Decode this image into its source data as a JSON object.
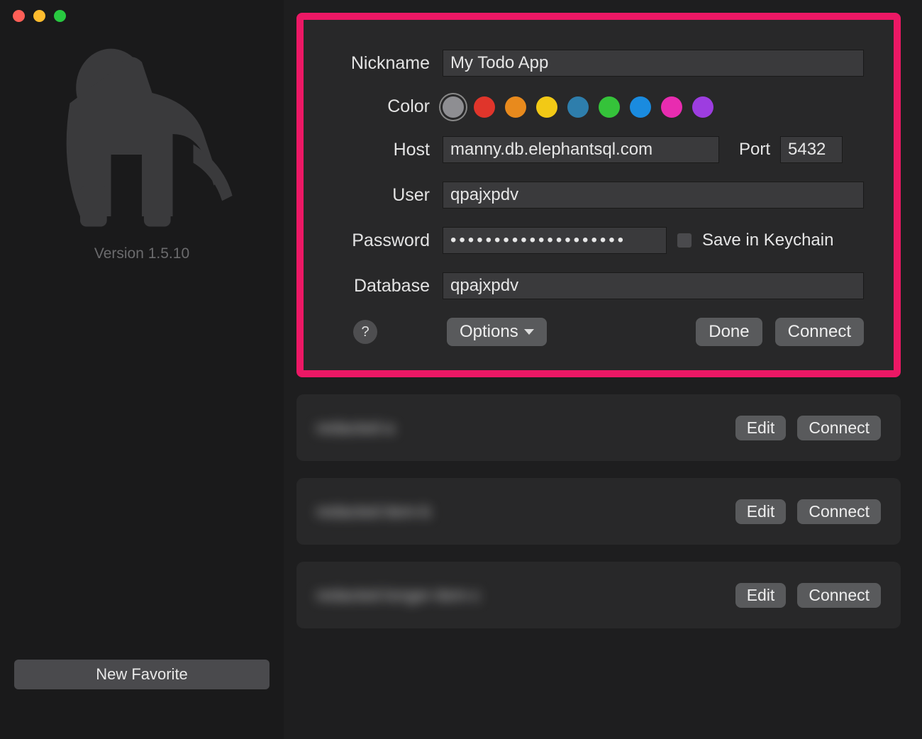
{
  "sidebar": {
    "version_text": "Version 1.5.10",
    "new_favorite_label": "New Favorite"
  },
  "editor": {
    "labels": {
      "nickname": "Nickname",
      "color": "Color",
      "host": "Host",
      "port": "Port",
      "user": "User",
      "password": "Password",
      "database": "Database",
      "save_keychain": "Save in Keychain"
    },
    "values": {
      "nickname": "My Todo App",
      "host": "manny.db.elephantsql.com",
      "port": "5432",
      "user": "qpajxpdv",
      "password": "••••••••••••••••••••",
      "database": "qpajxpdv",
      "save_keychain_checked": false
    },
    "colors": [
      {
        "name": "gray",
        "hex": "#8e8e92",
        "selected": true
      },
      {
        "name": "red",
        "hex": "#e0352b"
      },
      {
        "name": "orange",
        "hex": "#e88a1d"
      },
      {
        "name": "yellow",
        "hex": "#f2c916"
      },
      {
        "name": "teal",
        "hex": "#2e7eac"
      },
      {
        "name": "green",
        "hex": "#35c33a"
      },
      {
        "name": "blue",
        "hex": "#1a8bdf"
      },
      {
        "name": "magenta",
        "hex": "#e82cb0"
      },
      {
        "name": "purple",
        "hex": "#9d3de0"
      }
    ],
    "buttons": {
      "help": "?",
      "options": "Options",
      "done": "Done",
      "connect": "Connect"
    }
  },
  "saved": [
    {
      "name": "redacted-a",
      "edit": "Edit",
      "connect": "Connect"
    },
    {
      "name": "redacted-item-b",
      "edit": "Edit",
      "connect": "Connect"
    },
    {
      "name": "redacted-longer-item-c",
      "edit": "Edit",
      "connect": "Connect"
    }
  ]
}
